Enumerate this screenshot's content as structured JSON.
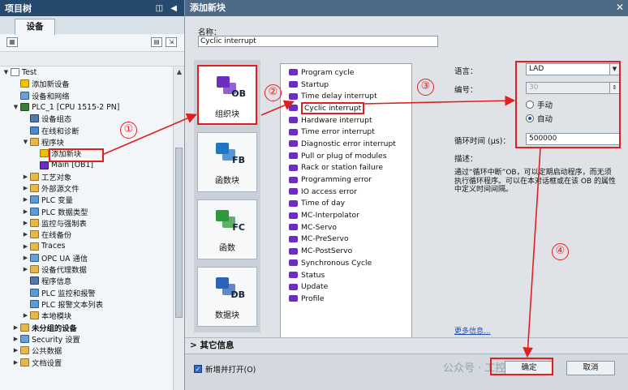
{
  "tree": {
    "title": "项目树",
    "title_controls": "◫ ◀",
    "tab": "设备",
    "items": [
      {
        "label": "Test",
        "exp": "▼",
        "icon": "doc",
        "indent": 0
      },
      {
        "label": "添加新设备",
        "exp": "",
        "icon": "star",
        "indent": 1
      },
      {
        "label": "设备和网络",
        "exp": "",
        "icon": "net",
        "indent": 1
      },
      {
        "label": "PLC_1 [CPU 1515-2 PN]",
        "exp": "▼",
        "icon": "cpu",
        "indent": 1
      },
      {
        "label": "设备组态",
        "exp": "",
        "icon": "cfg",
        "indent": 2
      },
      {
        "label": "在线和诊断",
        "exp": "",
        "icon": "diag",
        "indent": 2
      },
      {
        "label": "程序块",
        "exp": "▼",
        "icon": "fold",
        "indent": 2
      },
      {
        "label": "添加新块",
        "exp": "",
        "icon": "star",
        "indent": 3,
        "selected": true
      },
      {
        "label": "Main [OB1]",
        "exp": "",
        "icon": "ob",
        "indent": 3
      },
      {
        "label": "工艺对象",
        "exp": "▶",
        "icon": "fold",
        "indent": 2
      },
      {
        "label": "外部源文件",
        "exp": "▶",
        "icon": "fold",
        "indent": 2
      },
      {
        "label": "PLC 变量",
        "exp": "▶",
        "icon": "plc",
        "indent": 2
      },
      {
        "label": "PLC 数据类型",
        "exp": "▶",
        "icon": "plc",
        "indent": 2
      },
      {
        "label": "监控与强制表",
        "exp": "▶",
        "icon": "fold",
        "indent": 2
      },
      {
        "label": "在线备份",
        "exp": "▶",
        "icon": "fold",
        "indent": 2
      },
      {
        "label": "Traces",
        "exp": "▶",
        "icon": "fold",
        "indent": 2
      },
      {
        "label": "OPC UA 通信",
        "exp": "▶",
        "icon": "net",
        "indent": 2
      },
      {
        "label": "设备代理数据",
        "exp": "▶",
        "icon": "fold",
        "indent": 2
      },
      {
        "label": "程序信息",
        "exp": "",
        "icon": "cfg",
        "indent": 2
      },
      {
        "label": "PLC 监控和报警",
        "exp": "",
        "icon": "plc",
        "indent": 2
      },
      {
        "label": "PLC 报警文本列表",
        "exp": "",
        "icon": "plc",
        "indent": 2
      },
      {
        "label": "本地模块",
        "exp": "▶",
        "icon": "fold",
        "indent": 2
      },
      {
        "label": "未分组的设备",
        "exp": "▶",
        "icon": "fold",
        "indent": 1,
        "bold": true
      },
      {
        "label": "Security 设置",
        "exp": "▶",
        "icon": "net",
        "indent": 1
      },
      {
        "label": "公共数据",
        "exp": "▶",
        "icon": "fold",
        "indent": 1
      },
      {
        "label": "文档设置",
        "exp": "▶",
        "icon": "fold",
        "indent": 1
      }
    ]
  },
  "dialog": {
    "title": "添加新块",
    "close": "✕",
    "name_label": "名称：",
    "name_value": "Cyclic interrupt",
    "block_types": [
      {
        "caption": "组织块",
        "tag": "OB",
        "color": "#6b2fc0",
        "active": true
      },
      {
        "caption": "函数块",
        "tag": "FB",
        "color": "#1f77c4",
        "active": false
      },
      {
        "caption": "函数",
        "tag": "FC",
        "color": "#2c9a3a",
        "active": false
      },
      {
        "caption": "数据块",
        "tag": "DB",
        "color": "#2c62b8",
        "active": false
      }
    ],
    "ob_list": [
      {
        "label": "Program cycle"
      },
      {
        "label": "Startup"
      },
      {
        "label": "Time delay interrupt"
      },
      {
        "label": "Cyclic interrupt",
        "selected": true
      },
      {
        "label": "Hardware interrupt"
      },
      {
        "label": "Time error interrupt"
      },
      {
        "label": "Diagnostic error interrupt"
      },
      {
        "label": "Pull or plug of modules"
      },
      {
        "label": "Rack or station failure"
      },
      {
        "label": "Programming error"
      },
      {
        "label": "IO access error"
      },
      {
        "label": "Time of day"
      },
      {
        "label": "MC-Interpolator"
      },
      {
        "label": "MC-Servo"
      },
      {
        "label": "MC-PreServo"
      },
      {
        "label": "MC-PostServo"
      },
      {
        "label": "Synchronous Cycle"
      },
      {
        "label": "Status"
      },
      {
        "label": "Update"
      },
      {
        "label": "Profile"
      }
    ],
    "language_label": "语言：",
    "language_value": "LAD",
    "number_label": "编号：",
    "number_value": "30",
    "radio_manual": "手动",
    "radio_auto": "自动",
    "cycle_label": "循环时间 (μs)：",
    "cycle_value": "500000",
    "desc_label": "描述：",
    "desc_text": "通过“循环中断”OB，可以定期启动程序，而无须执行循环程序。可以在本对话框或在该 OB 的属性中定义时间间隔。",
    "more_info": "更多信息...",
    "extra_info": "其它信息",
    "open_check": "新增并打开(O)",
    "ok": "确定",
    "cancel": "取消",
    "watermark": "公众号 · 工控电子"
  },
  "callouts": [
    "①",
    "②",
    "③",
    "④"
  ],
  "colors": {
    "annotation": "#e02020",
    "title_bar": "#264a6e",
    "dialog_title": "#4e6a86"
  }
}
